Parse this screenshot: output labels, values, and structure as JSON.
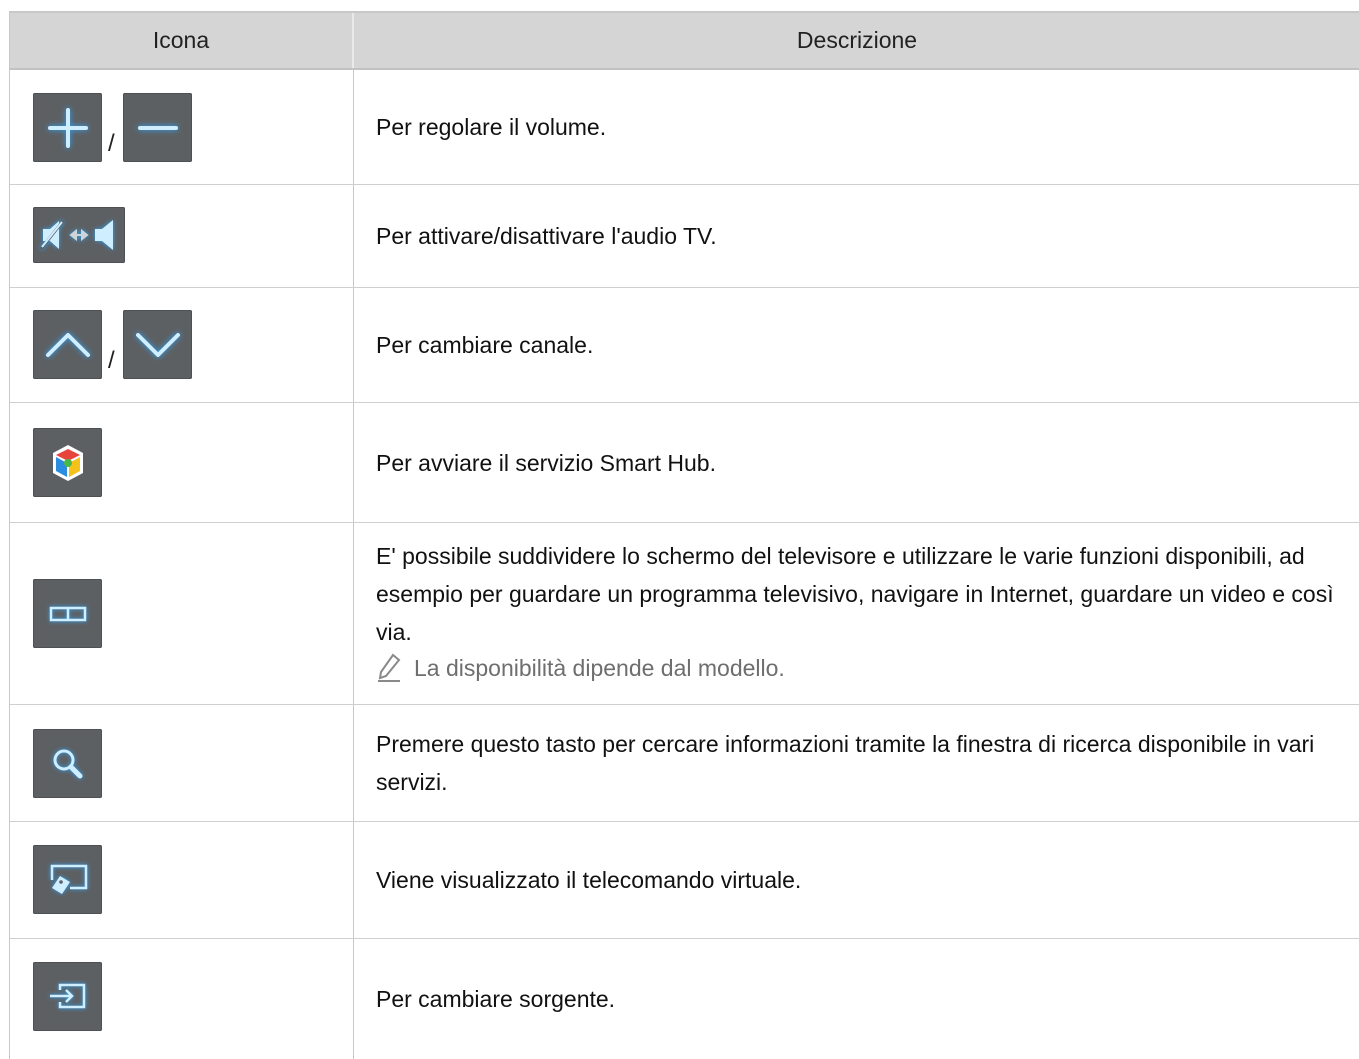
{
  "header": {
    "col_icon": "Icona",
    "col_desc": "Descrizione"
  },
  "rows": [
    {
      "icons": [
        "plus-icon",
        "minus-icon"
      ],
      "separator": "/",
      "description": "Per regolare il volume."
    },
    {
      "icons": [
        "mute-toggle-icon"
      ],
      "description": "Per attivare/disattivare l'audio TV."
    },
    {
      "icons": [
        "chevron-up-icon",
        "chevron-down-icon"
      ],
      "separator": "/",
      "description": "Per cambiare canale."
    },
    {
      "icons": [
        "smart-hub-icon"
      ],
      "description": "Per avviare il servizio Smart Hub."
    },
    {
      "icons": [
        "split-screen-icon"
      ],
      "description": "E' possibile suddividere lo schermo del televisore e utilizzare le varie funzioni disponibili, ad esempio per guardare un programma televisivo, navigare in Internet, guardare un video e così via.",
      "note": "La disponibilità dipende dal modello."
    },
    {
      "icons": [
        "search-icon"
      ],
      "description": "Premere questo tasto per cercare informazioni tramite la finestra di ricerca disponibile in vari servizi."
    },
    {
      "icons": [
        "virtual-remote-icon"
      ],
      "description": "Viene visualizzato il telecomando virtuale."
    },
    {
      "icons": [
        "source-icon"
      ],
      "description": "Per cambiare sorgente."
    }
  ],
  "colors": {
    "header_bg": "#d5d5d5",
    "icon_bg": "#5d6063",
    "icon_glow": "#2aa8ff",
    "note_text": "#6e6e6e"
  }
}
